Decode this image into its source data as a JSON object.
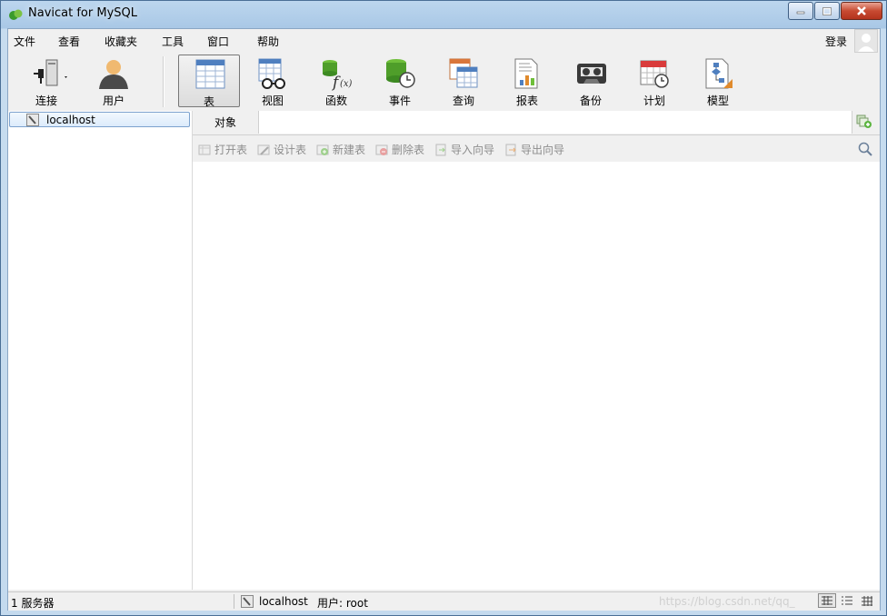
{
  "window": {
    "title": "Navicat for MySQL"
  },
  "menu": [
    "文件",
    "查看",
    "收藏夹",
    "工具",
    "窗口",
    "帮助"
  ],
  "login": "登录",
  "toolbar": {
    "connect": "连接",
    "user": "用户",
    "items": [
      "表",
      "视图",
      "函数",
      "事件",
      "查询",
      "报表",
      "备份",
      "计划",
      "模型"
    ]
  },
  "sidebar": {
    "connection": "localhost"
  },
  "objects": {
    "tab": "对象",
    "buttons": [
      "打开表",
      "设计表",
      "新建表",
      "删除表",
      "导入向导",
      "导出向导"
    ]
  },
  "status": {
    "servers": "1 服务器",
    "connection": "localhost",
    "user": "用户: root",
    "watermark": "https://blog.csdn.net/qq_"
  }
}
